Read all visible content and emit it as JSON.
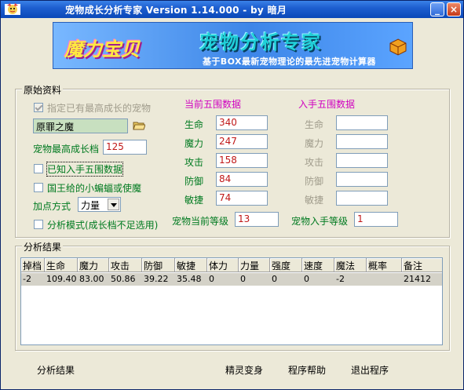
{
  "window": {
    "title": "宠物成长分析专家 Version 1.14.000 - by 暗月",
    "minimize_glyph": "_",
    "close_glyph": "×"
  },
  "banner": {
    "logo_text": "魔力宝贝",
    "title": "宠物分析专家",
    "subtitle": "基于BOX最新宠物理论的最先进宠物计算器"
  },
  "raw_data": {
    "legend": "原始资料",
    "specify_max_growth_label": "指定已有最高成长的宠物",
    "pet_name_value": "原罪之魔",
    "max_growth_label": "宠物最高成长档",
    "max_growth_value": "125",
    "known_initial_label": "已知入手五围数据",
    "king_bat_label": "国王给的小蝙蝠或使魔",
    "add_point_label": "加点方式",
    "add_point_value": "力量",
    "analysis_mode_label": "分析模式(成长档不足选用)"
  },
  "current_stats": {
    "header": "当前五围数据",
    "labels": [
      "生命",
      "魔力",
      "攻击",
      "防御",
      "敏捷"
    ],
    "values": [
      "340",
      "247",
      "158",
      "84",
      "74"
    ],
    "level_label": "宠物当前等级",
    "level_value": "13"
  },
  "initial_stats": {
    "header": "入手五围数据",
    "labels": [
      "生命",
      "魔力",
      "攻击",
      "防御",
      "敏捷"
    ],
    "values": [
      "",
      "",
      "",
      "",
      ""
    ],
    "level_label": "宠物入手等级",
    "level_value": "1"
  },
  "results": {
    "legend": "分析结果",
    "columns": [
      "掉档",
      "生命",
      "魔力",
      "攻击",
      "防御",
      "敏捷",
      "体力",
      "力量",
      "强度",
      "速度",
      "魔法",
      "概率",
      "备注"
    ],
    "rows": [
      [
        "-2",
        "109.40",
        "83.00",
        "50.86",
        "39.22",
        "35.48",
        "0",
        "0",
        "0",
        "0",
        "-2",
        "",
        "21412"
      ]
    ]
  },
  "footer": {
    "analyze_label": "分析结果",
    "transform_label": "精灵变身",
    "help_label": "程序帮助",
    "exit_label": "退出程序"
  }
}
